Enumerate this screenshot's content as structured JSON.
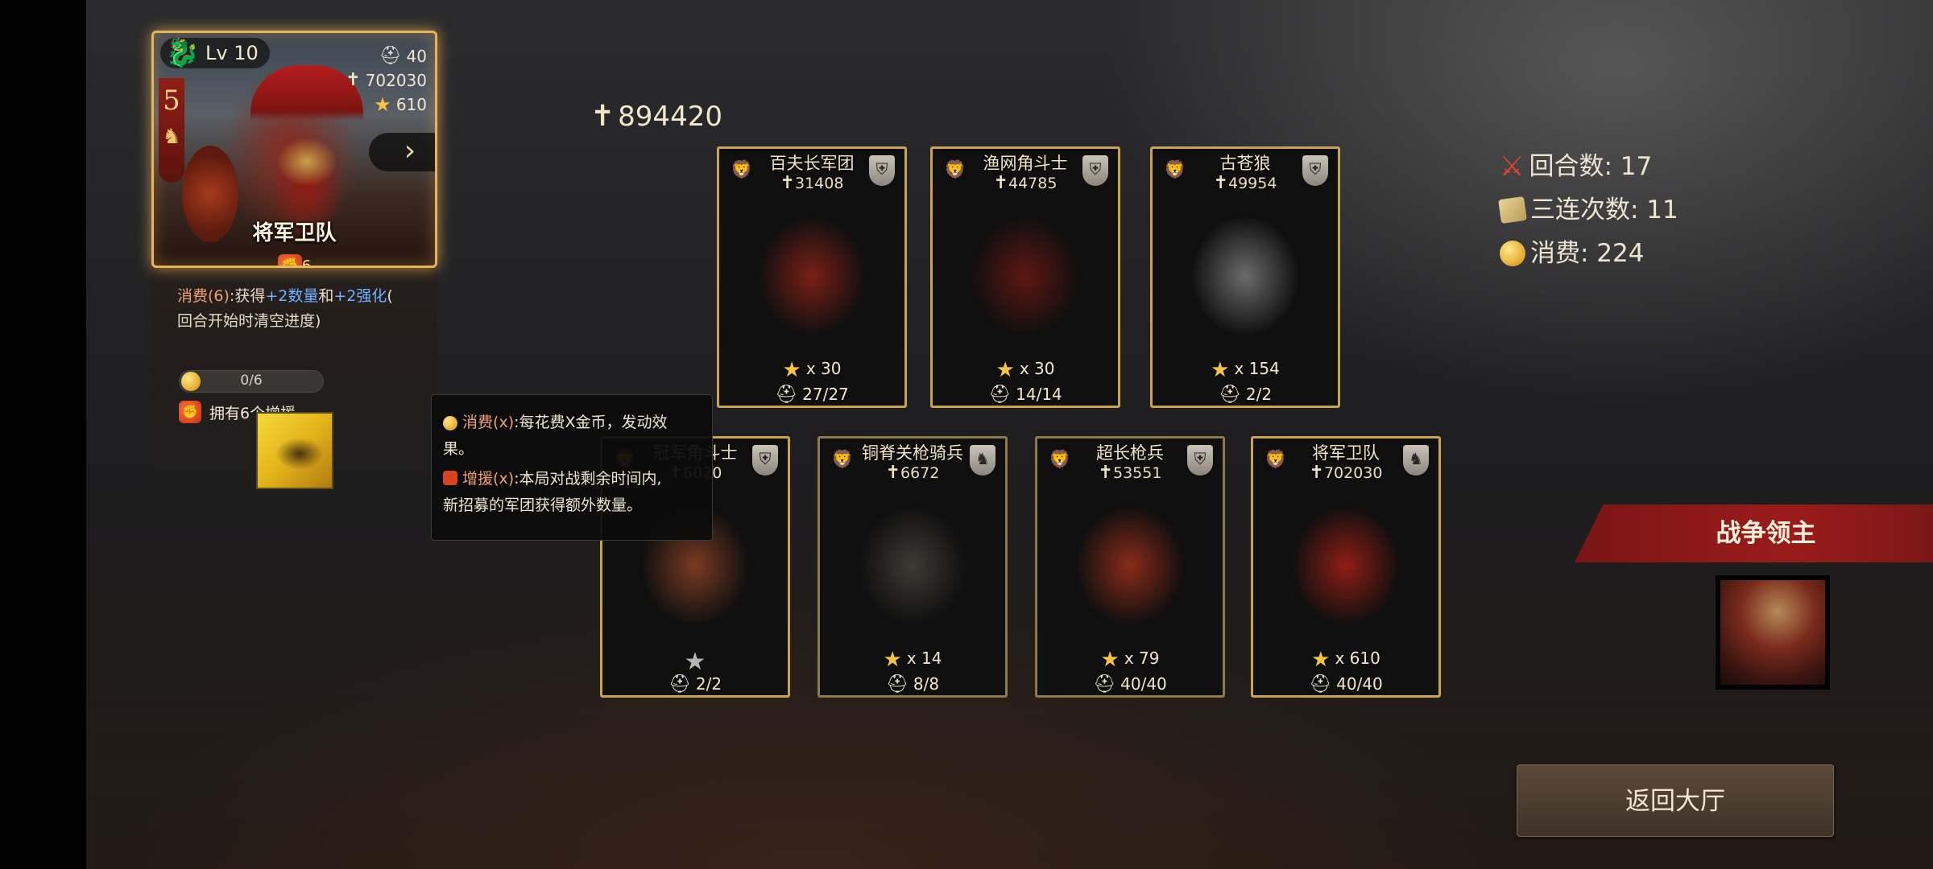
{
  "hero": {
    "level": "Lv 10",
    "rank": "5",
    "unit_count": "40",
    "power": "702030",
    "stars": "610",
    "name": "将军卫队",
    "ability_count": "6",
    "desc_cost_label": "消费(6)",
    "desc_part1": ":获得",
    "desc_amount": "+2数量",
    "desc_and": "和",
    "desc_enhance": "+2强化",
    "desc_paren_open": "(",
    "desc_line2": "回合开始时清空进度)",
    "progress_text": "0/6",
    "progress_fraction": 0.0,
    "reinforce_count": "6",
    "reinforce_text": "拥有6个增援"
  },
  "total_power": "894420",
  "units": [
    {
      "name": "百夫长军团",
      "power": "31408",
      "stars": "x 30",
      "count": "27/27",
      "art_color": "#7a1f17"
    },
    {
      "name": "渔网角斗士",
      "power": "44785",
      "stars": "x 30",
      "count": "14/14",
      "art_color": "#5d1712"
    },
    {
      "name": "古苍狼",
      "power": "49954",
      "stars": "x 154",
      "count": "2/2",
      "art_color": "#6b6b6b"
    },
    {
      "name": "冠军角斗士",
      "power": "6020",
      "stars": "",
      "count": "2/2",
      "art_color": "#7a3a22"
    },
    {
      "name": "铜脊关枪骑兵",
      "power": "6672",
      "stars": "x 14",
      "count": "8/8",
      "art_color": "#3e3a35"
    },
    {
      "name": "超长枪兵",
      "power": "53551",
      "stars": "x 79",
      "count": "40/40",
      "art_color": "#8a2b1a"
    },
    {
      "name": "将军卫队",
      "power": "702030",
      "stars": "x 610",
      "count": "40/40",
      "art_color": "#8f1e16"
    }
  ],
  "tooltip": {
    "cost_label": "消费(x)",
    "cost_text": ":每花费X金币，发动效",
    "cost_text2": "果。",
    "reinforce_label": "增援(x)",
    "reinforce_text": ":本局对战剩余时间内,",
    "reinforce_text2": "新招募的军团获得额外数量。"
  },
  "stats": {
    "rounds": "回合数: 17",
    "triples": "三连次数: 11",
    "spend": "消费: 224"
  },
  "warlord_label": "战争领主",
  "return_label": "返回大厅",
  "icons": {
    "helmet": "helmet-icon",
    "star": "star-icon",
    "dagger": "dagger-icon",
    "coin": "coin-icon",
    "fist": "fist-icon",
    "swords": "crossed-swords-icon",
    "cards": "cards-icon"
  }
}
